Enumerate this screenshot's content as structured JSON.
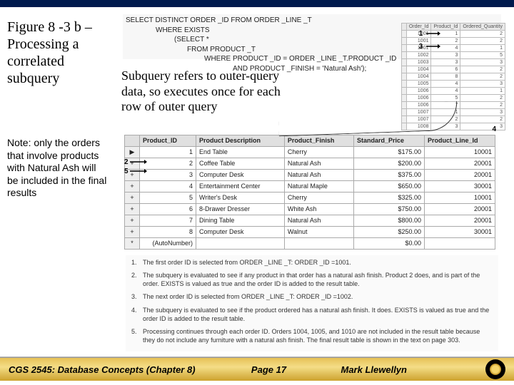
{
  "figure_title": "Figure 8 -3 b – Processing a correlated subquery",
  "subquery_caption": "Subquery refers to outer-query data, so executes once for each row of outer query",
  "note": "Note: only the orders that involve products with Natural Ash will be included in the final results",
  "sql": {
    "l1": "SELECT DISTINCT ORDER _ID FROM ORDER _LINE _T",
    "l2": "WHERE EXISTS",
    "l3": "(SELECT *",
    "l4": "FROM PRODUCT _T",
    "l5": "WHERE PRODUCT _ID = ORDER _LINE _T.PRODUCT _ID",
    "l6": "AND PRODUCT _FINISH = 'Natural Ash');"
  },
  "markers": {
    "m1": "1",
    "m2": "2",
    "m3": "3",
    "m4": "4",
    "m5": "5"
  },
  "order_table": {
    "headers": [
      "",
      "Order_Id",
      "Product_Id",
      "Ordered_Quantity"
    ],
    "rows": [
      [
        "",
        "1001",
        "1",
        "2"
      ],
      [
        "",
        "1001",
        "2",
        "2"
      ],
      [
        "",
        "1001",
        "4",
        "1"
      ],
      [
        "",
        "1002",
        "3",
        "5"
      ],
      [
        "",
        "1003",
        "3",
        "3"
      ],
      [
        "",
        "1004",
        "6",
        "2"
      ],
      [
        "",
        "1004",
        "8",
        "2"
      ],
      [
        "",
        "1005",
        "4",
        "3"
      ],
      [
        "",
        "1006",
        "4",
        "1"
      ],
      [
        "",
        "1006",
        "5",
        "2"
      ],
      [
        "",
        "1006",
        "7",
        "2"
      ],
      [
        "",
        "1007",
        "1",
        "3"
      ],
      [
        "",
        "1007",
        "2",
        "2"
      ],
      [
        "",
        "1008",
        "3",
        "3"
      ]
    ]
  },
  "product_table": {
    "headers": [
      "",
      "Product_ID",
      "Product Description",
      "Product_Finish",
      "Standard_Price",
      "Product_Line_Id"
    ],
    "rows": [
      [
        "▶",
        "1",
        "End Table",
        "Cherry",
        "$175.00",
        "10001"
      ],
      [
        "+",
        "2",
        "Coffee Table",
        "Natural Ash",
        "$200.00",
        "20001"
      ],
      [
        "+",
        "3",
        "Computer Desk",
        "Natural Ash",
        "$375.00",
        "20001"
      ],
      [
        "+",
        "4",
        "Entertainment Center",
        "Natural Maple",
        "$650.00",
        "30001"
      ],
      [
        "+",
        "5",
        "Writer's Desk",
        "Cherry",
        "$325.00",
        "10001"
      ],
      [
        "+",
        "6",
        "8-Drawer Dresser",
        "White Ash",
        "$750.00",
        "20001"
      ],
      [
        "+",
        "7",
        "Dining Table",
        "Natural Ash",
        "$800.00",
        "20001"
      ],
      [
        "+",
        "8",
        "Computer Desk",
        "Walnut",
        "$250.00",
        "30001"
      ],
      [
        "*",
        "(AutoNumber)",
        "",
        "",
        "$0.00",
        ""
      ]
    ]
  },
  "steps": {
    "s1": {
      "n": "1.",
      "t": "The first order ID is selected from ORDER _LINE _T: ORDER _ID =1001."
    },
    "s2": {
      "n": "2.",
      "t": "The subquery is evaluated to see if any product in that order has a natural ash finish. Product 2 does, and is part of the order. EXISTS is valued as true and the order ID is added to the result table."
    },
    "s3": {
      "n": "3.",
      "t": "The next order ID is selected from ORDER _LINE _T: ORDER _ID =1002."
    },
    "s4": {
      "n": "4.",
      "t": "The subquery is evaluated to see if the product ordered has a natural ash finish. It does. EXISTS is valued as true and the order ID is added to the result table."
    },
    "s5": {
      "n": "5.",
      "t": "Processing continues through each order ID. Orders 1004, 1005, and 1010 are not included in the result table because they do not include any furniture with a natural ash finish. The final result table is shown in the text on page 303."
    }
  },
  "footer": {
    "course": "CGS 2545: Database Concepts  (Chapter 8)",
    "page": "Page 17",
    "author": "Mark Llewellyn"
  }
}
